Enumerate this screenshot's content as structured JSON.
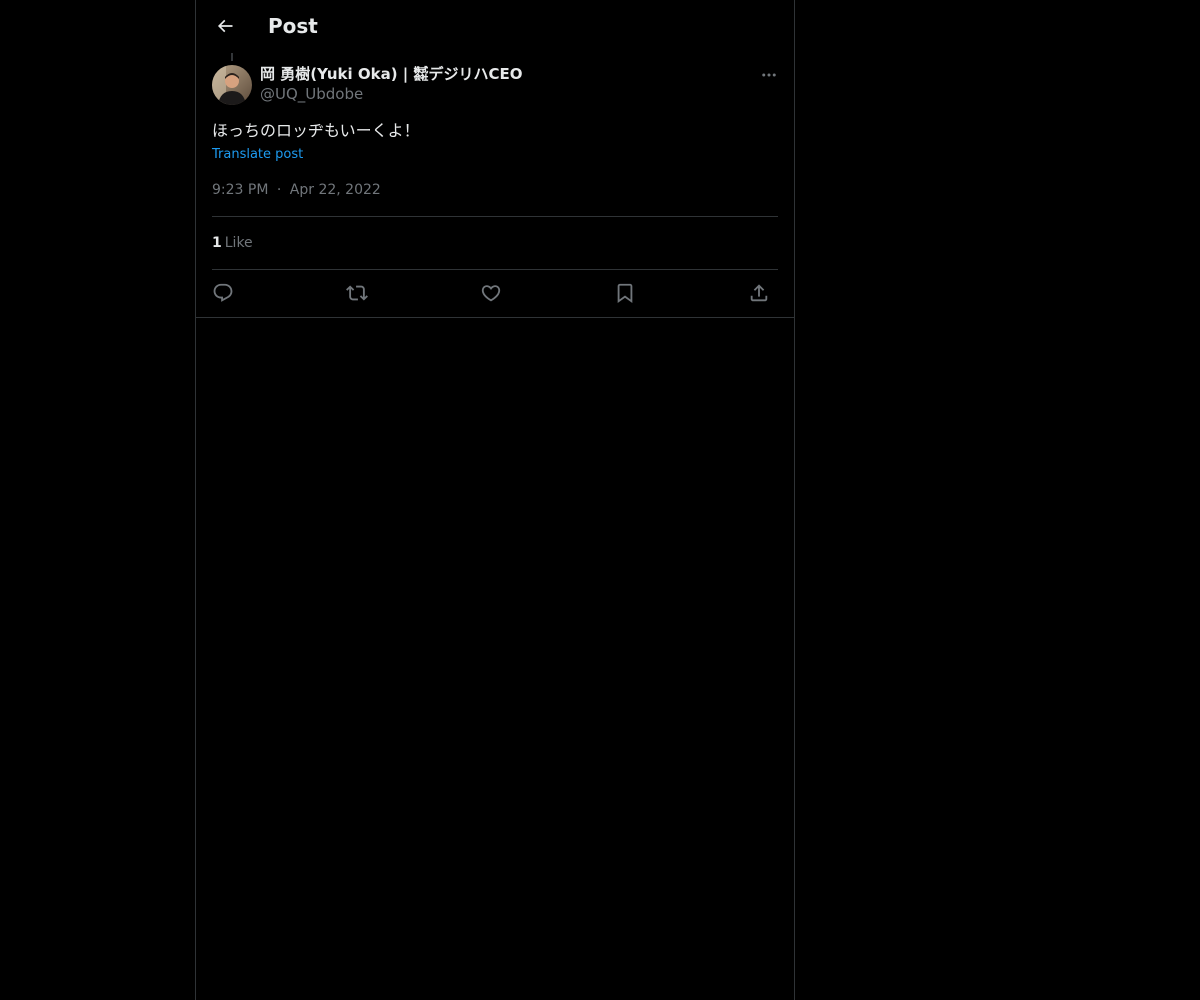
{
  "header": {
    "title": "Post"
  },
  "post": {
    "author": {
      "display_name": "岡 勇樹(Yuki Oka) | ㍿デジリハCEO",
      "handle": "@UQ_Ubdobe"
    },
    "text": "ほっちのロッヂもいーくよ！",
    "translate_label": "Translate post",
    "time": "9:23 PM",
    "separator": "·",
    "date": "Apr 22, 2022",
    "likes": {
      "count": "1",
      "label": "Like"
    }
  },
  "actions": [
    "reply-icon",
    "repost-icon",
    "like-icon",
    "bookmark-icon",
    "share-icon"
  ],
  "colors": {
    "background": "#000000",
    "text": "#e7e9ea",
    "secondary": "#71767b",
    "link": "#1d9bf0",
    "border": "#2f3336"
  }
}
